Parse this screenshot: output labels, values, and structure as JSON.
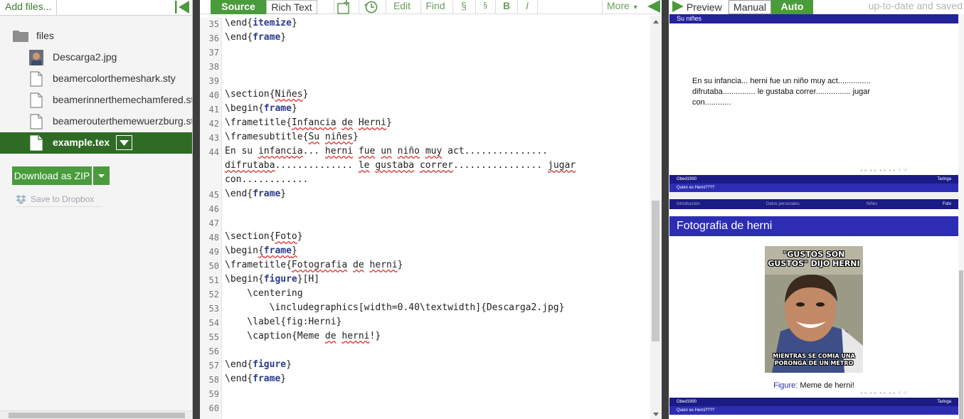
{
  "left_panel": {
    "add_files_label": "Add files...",
    "files": [
      {
        "type": "folder",
        "name": "files"
      },
      {
        "type": "image",
        "name": "Descarga2.jpg"
      },
      {
        "type": "file",
        "name": "beamercolorthemeshark.sty"
      },
      {
        "type": "file",
        "name": "beamerinnerthemechamfered.sty"
      },
      {
        "type": "file",
        "name": "beamerouterthemewuerzburg.sty"
      },
      {
        "type": "file",
        "name": "example.tex",
        "active": true
      }
    ],
    "download_label": "Download as ZIP",
    "dropbox_label": "Save to Dropbox"
  },
  "toolbar": {
    "source_tab": "Source",
    "rich_text_tab": "Rich Text",
    "edit": "Edit",
    "find": "Find",
    "section1": "§",
    "section2": "§",
    "bold": "B",
    "italic": "I",
    "more": "More"
  },
  "editor": {
    "line_numbers": [
      "35",
      "36",
      "37",
      "38",
      "39",
      "40",
      "41",
      "42",
      "43",
      "44",
      "",
      "",
      "45",
      "46",
      "47",
      "48",
      "49",
      "50",
      "51",
      "52",
      "53",
      "54",
      "55",
      "56",
      "57",
      "58",
      "59",
      "60"
    ]
  },
  "preview": {
    "preview_label": "Preview",
    "manual_label": "Manual",
    "auto_label": "Auto",
    "status": "up-to-date and saved",
    "slide1": {
      "subtitle": "Su niñes",
      "body_line1": "En su infancia... herni fue un niño muy act...............",
      "body_line2": "difrutaba............... le gustaba correr................ jugar",
      "body_line3": "con............",
      "footer_author": "Obed1990",
      "footer_right": "Taringa",
      "footer_title": "Quien es Herni????"
    },
    "slide2": {
      "nav": [
        "Introduccion",
        "Datos personales",
        "Niñes",
        "Foto"
      ],
      "title": "Fotografia de herni",
      "meme_top": "\"GUSTOS SON GUSTOS\" DIJO HERNI",
      "meme_bottom": "MIENTRAS SE COMIA UNA PORONGA DE UN METRO",
      "caption_label": "Figure:",
      "caption_text": " Meme de herni!",
      "footer_author": "Obed1990",
      "footer_right": "Taringa",
      "footer_title": "Quien es Herni????"
    }
  },
  "colors": {
    "accent_green": "#4a9b3c",
    "dark_green": "#2f6b25",
    "beamer_blue": "#2d2db4",
    "beamer_dark": "#1b1b85"
  }
}
